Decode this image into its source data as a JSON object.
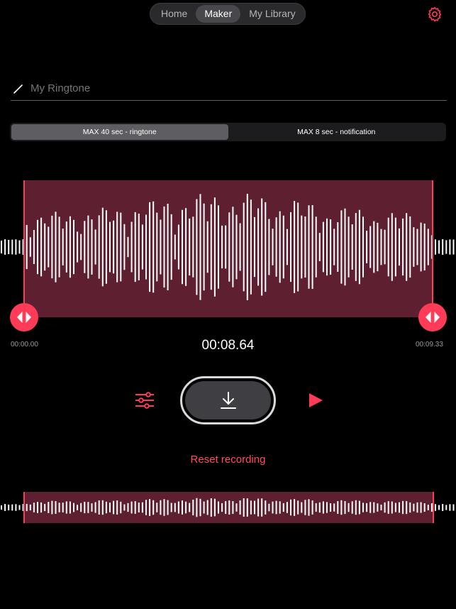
{
  "nav": {
    "tabs": [
      {
        "label": "Home",
        "active": false
      },
      {
        "label": "Maker",
        "active": true
      },
      {
        "label": "My Library",
        "active": false
      }
    ]
  },
  "settings_icon": "gear-icon",
  "title_field": {
    "placeholder": "My Ringtone",
    "value": ""
  },
  "mode_segment": {
    "options": [
      "MAX 40 sec - ringtone",
      "MAX 8 sec - notification"
    ],
    "selected_index": 0
  },
  "editor": {
    "start_time": "00:00.00",
    "current_time": "00:08.64",
    "end_time": "00:09.33"
  },
  "controls": {
    "equalizer_icon": "sliders-icon",
    "download_icon": "download-arrow-icon",
    "play_icon": "play-icon"
  },
  "reset_label": "Reset recording",
  "colors": {
    "accent": "#ff3b57",
    "selection_fill": "#5e1f31",
    "background": "#000000"
  }
}
